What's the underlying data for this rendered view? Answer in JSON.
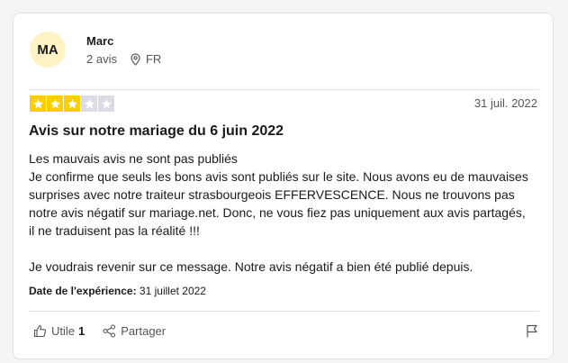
{
  "review": {
    "avatar_initials": "MA",
    "author_name": "Marc",
    "review_count": "2 avis",
    "country": "FR",
    "rating": 3,
    "rating_max": 5,
    "date": "31 juil. 2022",
    "title": "Avis sur notre mariage du 6 juin 2022",
    "body_lines": [
      "Les mauvais avis ne sont pas publiés",
      "Je confirme que seuls les bons avis sont publiés sur le site. Nous avons eu de mauvaises surprises avec notre traiteur strasbourgeois EFFERVESCENCE. Nous ne trouvons pas notre avis négatif sur mariage.net. Donc, ne vous fiez pas uniquement aux avis partagés, il ne traduisent pas la réalité !!!",
      "Je voudrais revenir sur ce message. Notre avis négatif a bien été publié depuis."
    ],
    "experience_label": "Date de l'expérience:",
    "experience_date": "31 juillet 2022"
  },
  "actions": {
    "useful_label": "Utile",
    "useful_count": "1",
    "share_label": "Partager"
  },
  "icons": {
    "location": "location-pin-icon",
    "star": "star-icon",
    "thumbs_up": "thumbs-up-icon",
    "share": "share-icon",
    "flag": "flag-icon"
  },
  "colors": {
    "star_on": "#ffce00",
    "star_off": "#dcdce6",
    "avatar_bg": "#fdf3c4"
  }
}
